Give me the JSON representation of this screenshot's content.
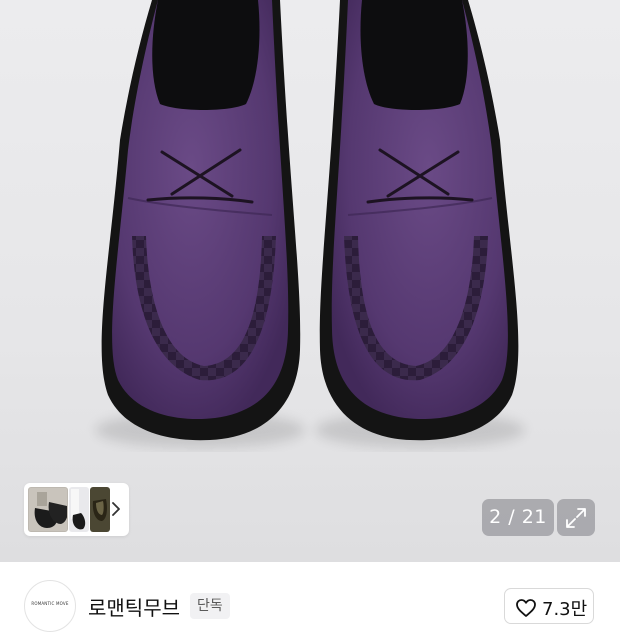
{
  "gallery": {
    "photo_alt": "Purple suede creeper shoes",
    "page_counter": "2 / 21",
    "thumbnails": [
      "thumbnail-1",
      "thumbnail-2",
      "thumbnail-3"
    ],
    "colors": {
      "suede": "#5a3c72",
      "sole": "#141414",
      "background": "#e8e8ea"
    }
  },
  "seller": {
    "logo_text": "ROMANTIC MOVE",
    "name": "로맨틱무브",
    "badge": "단독"
  },
  "like": {
    "count": "7.3만"
  }
}
